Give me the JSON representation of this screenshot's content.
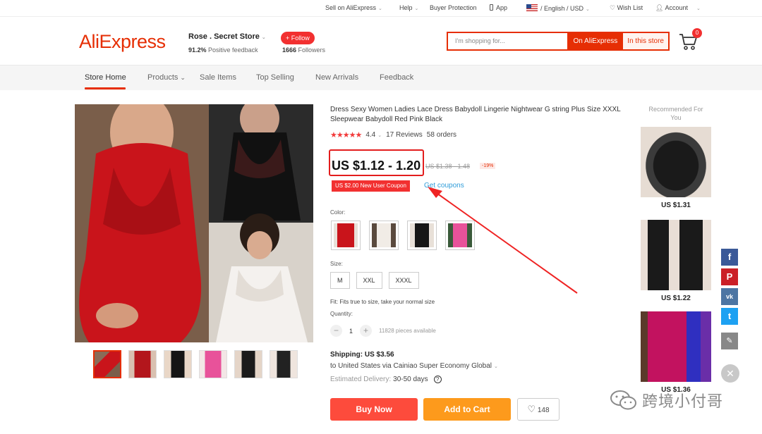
{
  "topbar": {
    "sell": "Sell on AliExpress",
    "help": "Help",
    "buyer_protection": "Buyer Protection",
    "app": "App",
    "language_currency": "/ English /  USD",
    "wish_list": "Wish List",
    "account": "Account"
  },
  "header": {
    "logo": "AliExpress",
    "store_name": "Rose . Secret Store",
    "feedback_pct": "91.2%",
    "feedback_label": "Positive feedback",
    "follow": "+ Follow",
    "followers_count": "1666",
    "followers_label": "Followers",
    "search_placeholder": "I'm shopping for...",
    "search_on_ali": "On AliExpress",
    "search_in_store": "In this store",
    "cart_count": "0"
  },
  "store_nav": {
    "items": [
      "Store Home",
      "Products",
      "Sale Items",
      "Top Selling",
      "New Arrivals",
      "Feedback"
    ]
  },
  "product": {
    "title": "Dress Sexy Women Ladies Lace Dress Babydoll Lingerie Nightwear G string Plus Size XXXL Sleepwear Babydoll Red Pink Black",
    "rating_value": "4.4",
    "rating_stars": 4.4,
    "reviews": "17 Reviews",
    "orders": "58 orders",
    "price": "US $1.12 - 1.20",
    "old_price": "US $1.38 - 1.48",
    "discount": "-19%",
    "coupon": "US $2.00 New User Coupon",
    "get_coupons": "Get coupons",
    "color_label": "Color:",
    "size_label": "Size:",
    "sizes": [
      "M",
      "XXL",
      "XXXL"
    ],
    "fit_text": "Fit: Fits true to size, take your normal size",
    "quantity_label": "Quantity:",
    "quantity": "1",
    "available": "11828 pieces available",
    "shipping": "Shipping: US $3.56",
    "ship_to": "to United States via Cainiao Super Economy Global",
    "delivery_label": "Estimated Delivery:",
    "delivery_days": "30-50 days",
    "buy_now": "Buy Now",
    "add_to_cart": "Add to Cart",
    "wish_count": "148"
  },
  "recommended": {
    "title": "Recommended For You",
    "items": [
      {
        "price": "US $1.31"
      },
      {
        "price": "US $1.22"
      },
      {
        "price": "US $1.36"
      }
    ]
  },
  "watermark": {
    "text": "跨境小付哥"
  },
  "colors": {
    "brand": "#e62e04",
    "buy": "#fd4b3c",
    "cart": "#fd9a1c",
    "link": "#2e9cd9"
  }
}
